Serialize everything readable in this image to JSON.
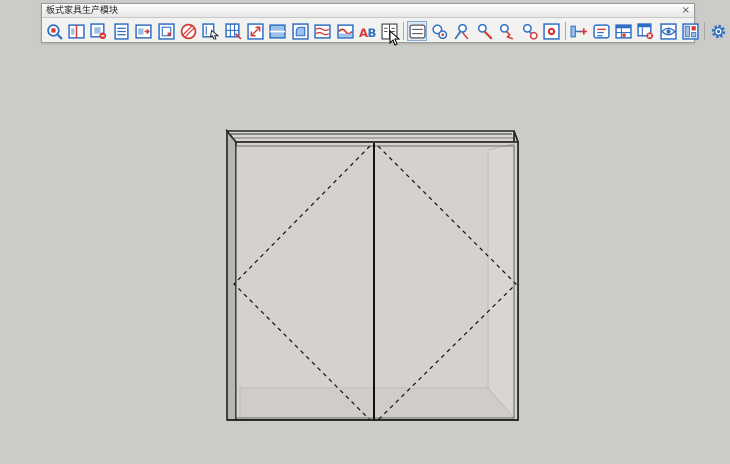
{
  "toolbar": {
    "title": "板式家具生产模块",
    "close_label": "×",
    "icons": [
      "zoom-plank-icon",
      "split-panel-icon",
      "delete-panel-icon",
      "list-icon",
      "move-panel-icon",
      "panel-frame-icon",
      "hatch-icon",
      "select-panel-icon",
      "grid-panel-icon",
      "resize-icon",
      "horizontal-panel-icon",
      "rounded-panel-icon",
      "texture-icon",
      "wave-panel-icon",
      "ab-swap-icon",
      "columns-icon",
      "hinge-door-icon",
      "drill-tool-1-icon",
      "drill-tool-2-icon",
      "drill-tool-3-icon",
      "drill-tool-4-icon",
      "drill-tool-5-icon",
      "target-icon",
      "connector-icon",
      "label-icon",
      "table-icon",
      "table-delete-icon",
      "view-icon",
      "layout-icon",
      "settings-icon"
    ]
  },
  "colors": {
    "background": "#cbcbc7",
    "toolbar_bg": "#f2f2f0",
    "icon_blue": "#2f6fc4",
    "icon_red": "#d43a3a",
    "door_fill": "#d6d1cf",
    "cabinet_edge": "#222222"
  },
  "scene": {
    "object": "cabinet",
    "door_count": 2,
    "door_swing_lines": "dashed"
  }
}
